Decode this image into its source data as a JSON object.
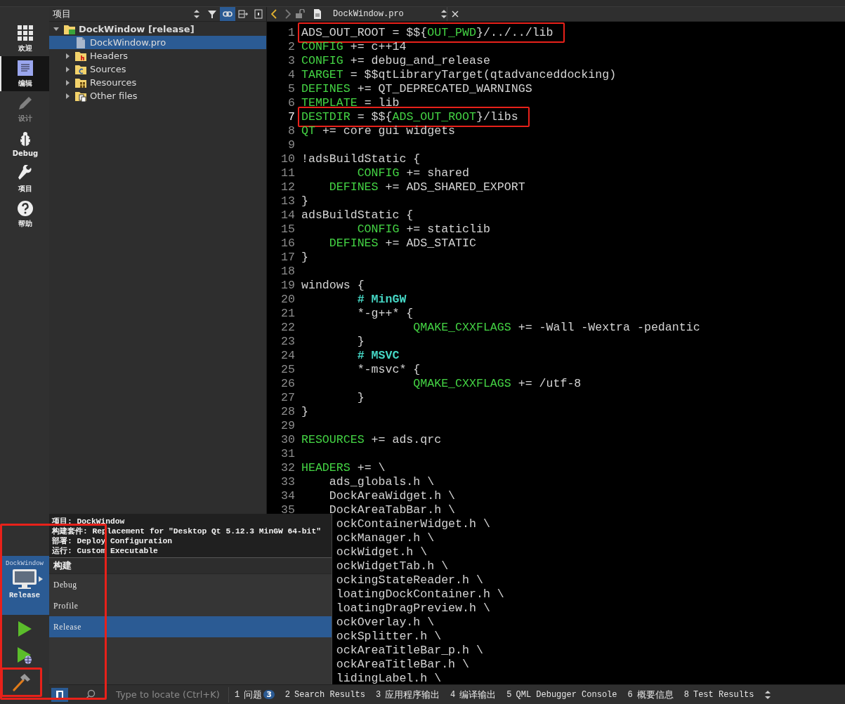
{
  "mode_bar": {
    "items": [
      {
        "label": "欢迎",
        "kind": "welcome",
        "selected": false,
        "disabled": false
      },
      {
        "label": "编辑",
        "kind": "edit",
        "selected": true,
        "disabled": false
      },
      {
        "label": "设计",
        "kind": "design",
        "selected": false,
        "disabled": true
      },
      {
        "label": "Debug",
        "kind": "debug",
        "selected": false,
        "disabled": false
      },
      {
        "label": "项目",
        "kind": "projects",
        "selected": false,
        "disabled": false
      },
      {
        "label": "帮助",
        "kind": "help",
        "selected": false,
        "disabled": false
      }
    ],
    "kit": {
      "project": "DockWindow",
      "build": "Release"
    },
    "run_buttons": [
      {
        "kind": "run",
        "highlighted": false
      },
      {
        "kind": "debug_run",
        "highlighted": false
      },
      {
        "kind": "build",
        "highlighted": true
      }
    ]
  },
  "project_panel": {
    "title": "项目",
    "tree": [
      {
        "label": "DockWindow [release]",
        "kind": "project",
        "expanded": true,
        "selected": false,
        "children": [
          {
            "label": "DockWindow.pro",
            "kind": "file",
            "selected": true
          },
          {
            "label": "Headers",
            "kind": "headers",
            "expanded": false,
            "selected": false
          },
          {
            "label": "Sources",
            "kind": "sources",
            "expanded": false,
            "selected": false
          },
          {
            "label": "Resources",
            "kind": "resources",
            "expanded": false,
            "selected": false
          },
          {
            "label": "Other files",
            "kind": "other",
            "expanded": false,
            "selected": false
          }
        ]
      }
    ]
  },
  "editor": {
    "back_enabled": true,
    "forward_enabled": false,
    "file": "DockWindow.pro",
    "lines": [
      {
        "number": "1",
        "highlighted": true,
        "current": false,
        "segments": [
          {
            "kind": "text",
            "text": "ADS_OUT_ROOT = $${"
          },
          {
            "kind": "keyword",
            "text": "OUT_PWD"
          },
          {
            "kind": "text",
            "text": "}/../../lib"
          }
        ]
      },
      {
        "number": "2",
        "highlighted": false,
        "current": false,
        "segments": [
          {
            "kind": "keyword",
            "text": "CONFIG"
          },
          {
            "kind": "text",
            "text": " += c++14"
          }
        ]
      },
      {
        "number": "3",
        "highlighted": false,
        "current": false,
        "segments": [
          {
            "kind": "keyword",
            "text": "CONFIG"
          },
          {
            "kind": "text",
            "text": " += debug_and_release"
          }
        ]
      },
      {
        "number": "4",
        "highlighted": false,
        "current": false,
        "segments": [
          {
            "kind": "keyword",
            "text": "TARGET"
          },
          {
            "kind": "text",
            "text": " = $$qtLibraryTarget(qtadvanceddocking)"
          }
        ]
      },
      {
        "number": "5",
        "highlighted": false,
        "current": false,
        "segments": [
          {
            "kind": "keyword",
            "text": "DEFINES"
          },
          {
            "kind": "text",
            "text": " += QT_DEPRECATED_WARNINGS"
          }
        ]
      },
      {
        "number": "6",
        "highlighted": false,
        "current": false,
        "segments": [
          {
            "kind": "keyword",
            "text": "TEMPLATE"
          },
          {
            "kind": "text",
            "text": " = lib"
          }
        ]
      },
      {
        "number": "7",
        "highlighted": true,
        "current": true,
        "segments": [
          {
            "kind": "keyword",
            "text": "DESTDIR"
          },
          {
            "kind": "text",
            "text": " = $${"
          },
          {
            "kind": "keyword",
            "text": "ADS_OUT_ROOT"
          },
          {
            "kind": "text",
            "text": "}/libs"
          }
        ]
      },
      {
        "number": "8",
        "highlighted": false,
        "current": false,
        "segments": [
          {
            "kind": "keyword",
            "text": "QT"
          },
          {
            "kind": "text",
            "text": " += core gui widgets"
          }
        ]
      },
      {
        "number": "9",
        "current": false
      },
      {
        "number": "10",
        "highlighted": false,
        "current": false,
        "segments": [
          {
            "kind": "text",
            "text": "!adsBuildStatic {"
          }
        ]
      },
      {
        "number": "11",
        "highlighted": false,
        "current": false,
        "segments": [
          {
            "kind": "keyword",
            "text": "        CONFIG"
          },
          {
            "kind": "text",
            "text": " += shared"
          }
        ]
      },
      {
        "number": "12",
        "highlighted": false,
        "current": false,
        "segments": [
          {
            "kind": "keyword",
            "text": "    DEFINES"
          },
          {
            "kind": "text",
            "text": " += ADS_SHARED_EXPORT"
          }
        ]
      },
      {
        "number": "13",
        "highlighted": false,
        "current": false,
        "segments": [
          {
            "kind": "text",
            "text": "}"
          }
        ]
      },
      {
        "number": "14",
        "highlighted": false,
        "current": false,
        "segments": [
          {
            "kind": "text",
            "text": "adsBuildStatic {"
          }
        ]
      },
      {
        "number": "15",
        "highlighted": false,
        "current": false,
        "segments": [
          {
            "kind": "keyword",
            "text": "        CONFIG"
          },
          {
            "kind": "text",
            "text": " += staticlib"
          }
        ]
      },
      {
        "number": "16",
        "highlighted": false,
        "current": false,
        "segments": [
          {
            "kind": "keyword",
            "text": "    DEFINES"
          },
          {
            "kind": "text",
            "text": " += ADS_STATIC"
          }
        ]
      },
      {
        "number": "17",
        "highlighted": false,
        "current": false,
        "segments": [
          {
            "kind": "text",
            "text": "}"
          }
        ]
      },
      {
        "number": "18",
        "current": false
      },
      {
        "number": "19",
        "highlighted": false,
        "current": false,
        "segments": [
          {
            "kind": "text",
            "text": "windows {"
          }
        ]
      },
      {
        "number": "20",
        "highlighted": false,
        "current": false,
        "segments": [
          {
            "kind": "comment",
            "text": "        # MinGW"
          }
        ]
      },
      {
        "number": "21",
        "highlighted": false,
        "current": false,
        "segments": [
          {
            "kind": "text",
            "text": "        *-g++* {"
          }
        ]
      },
      {
        "number": "22",
        "highlighted": false,
        "current": false,
        "segments": [
          {
            "kind": "keyword",
            "text": "                QMAKE_CXXFLAGS"
          },
          {
            "kind": "text",
            "text": " += -Wall -Wextra -pedantic"
          }
        ]
      },
      {
        "number": "23",
        "highlighted": false,
        "current": false,
        "segments": [
          {
            "kind": "text",
            "text": "        }"
          }
        ]
      },
      {
        "number": "24",
        "highlighted": false,
        "current": false,
        "segments": [
          {
            "kind": "comment",
            "text": "        # MSVC"
          }
        ]
      },
      {
        "number": "25",
        "highlighted": false,
        "current": false,
        "segments": [
          {
            "kind": "text",
            "text": "        *-msvc* {"
          }
        ]
      },
      {
        "number": "26",
        "highlighted": false,
        "current": false,
        "segments": [
          {
            "kind": "keyword",
            "text": "                QMAKE_CXXFLAGS"
          },
          {
            "kind": "text",
            "text": " += /utf-8"
          }
        ]
      },
      {
        "number": "27",
        "highlighted": false,
        "current": false,
        "segments": [
          {
            "kind": "text",
            "text": "        }"
          }
        ]
      },
      {
        "number": "28",
        "highlighted": false,
        "current": false,
        "segments": [
          {
            "kind": "text",
            "text": "}"
          }
        ]
      },
      {
        "number": "29",
        "current": false
      },
      {
        "number": "30",
        "highlighted": false,
        "current": false,
        "segments": [
          {
            "kind": "keyword",
            "text": "RESOURCES"
          },
          {
            "kind": "text",
            "text": " += ads.qrc"
          }
        ]
      },
      {
        "number": "31",
        "current": false
      },
      {
        "number": "32",
        "highlighted": false,
        "current": false,
        "segments": [
          {
            "kind": "keyword",
            "text": "HEADERS"
          },
          {
            "kind": "text",
            "text": " += \\"
          }
        ]
      },
      {
        "number": "33",
        "highlighted": false,
        "current": false,
        "segments": [
          {
            "kind": "text",
            "text": "    ads_globals.h \\"
          }
        ]
      },
      {
        "number": "34",
        "highlighted": false,
        "current": false,
        "segments": [
          {
            "kind": "text",
            "text": "    DockAreaWidget.h \\"
          }
        ]
      },
      {
        "number": "35",
        "highlighted": false,
        "current": false,
        "segments": [
          {
            "kind": "text",
            "text": "    DockAreaTabBar.h \\"
          }
        ]
      },
      {
        "kind": "partial",
        "text": "ockContainerWidget.h \\"
      },
      {
        "kind": "partial",
        "text": "ockManager.h \\"
      },
      {
        "kind": "partial",
        "text": "ockWidget.h \\"
      },
      {
        "kind": "partial",
        "text": "ockWidgetTab.h \\"
      },
      {
        "kind": "partial",
        "text": "ockingStateReader.h \\"
      },
      {
        "kind": "partial",
        "text": "loatingDockContainer.h \\"
      },
      {
        "kind": "partial",
        "text": "loatingDragPreview.h \\"
      },
      {
        "kind": "partial",
        "text": "ockOverlay.h \\"
      },
      {
        "kind": "partial",
        "text": "ockSplitter.h \\"
      },
      {
        "kind": "partial",
        "text": "ockAreaTitleBar_p.h \\"
      },
      {
        "kind": "partial",
        "text": "ockAreaTitleBar.h \\"
      },
      {
        "kind": "partial",
        "text": "lidingLabel.h \\"
      }
    ]
  },
  "kit_popup": {
    "highlighted": true,
    "info": [
      "项目: DockWindow",
      "构建套件: Replacement for \"Desktop Qt 5.12.3 MinGW 64-bit\"",
      "部署: Deploy Configuration",
      "运行: Custom Executable"
    ],
    "section": "构建",
    "options": [
      {
        "label": "Debug",
        "selected": false
      },
      {
        "label": "Profile",
        "selected": false
      },
      {
        "label": "Release",
        "selected": true
      }
    ]
  },
  "status_bar": {
    "search_placeholder": "Type to locate (Ctrl+K)",
    "panes": [
      {
        "number": "1",
        "label": "问题",
        "badge": "3"
      },
      {
        "number": "2",
        "label": "Search Results"
      },
      {
        "number": "3",
        "label": "应用程序输出"
      },
      {
        "number": "4",
        "label": "编译输出"
      },
      {
        "number": "5",
        "label": "QML Debugger Console"
      },
      {
        "number": "6",
        "label": "概要信息"
      },
      {
        "number": "8",
        "label": "Test Results"
      }
    ]
  }
}
